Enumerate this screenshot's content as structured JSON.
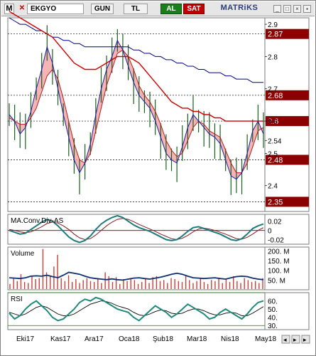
{
  "toolbar": {
    "logo_label": "M",
    "close_label": "✕",
    "symbol": "EKGYO",
    "period": "GUN",
    "currency": "TL",
    "buy_label": "AL",
    "sell_label": "SAT",
    "brand": "MATRiKS"
  },
  "colors": {
    "price_up": "#1b5e20",
    "ma_fast": "#1a1aa8",
    "ma_mid": "#cc0000",
    "ma_slow": "#000080",
    "band_fill": "#f4a3a3",
    "price_label_bg": "#8b0000",
    "volume_bar": "#c8403a",
    "macd_line": "#1f7a7a",
    "signal_line": "#7a1f1f"
  },
  "chart_data": [
    {
      "type": "line",
      "name": "price-panel",
      "title": "",
      "x_labels": [
        "Eki17",
        "Kas17",
        "Ara17",
        "Oca18",
        "Şub18",
        "Mar18",
        "Nis18",
        "May18"
      ],
      "price_levels": [
        "2.87",
        "2.68",
        "2.6",
        "2.48",
        "2.35"
      ],
      "y_ticks": [
        "2.9",
        "2.8",
        "2.7",
        "2.6",
        "2.54",
        "2.5",
        "2.4"
      ],
      "ylim": [
        2.32,
        2.92
      ],
      "series": [
        {
          "values": [
            2.62,
            2.6,
            2.56,
            2.58,
            2.63,
            2.7,
            2.76,
            2.83,
            2.78,
            2.7,
            2.62,
            2.55,
            2.48,
            2.44,
            2.47,
            2.53,
            2.62,
            2.7,
            2.76,
            2.8,
            2.85,
            2.82,
            2.77,
            2.72,
            2.68,
            2.66,
            2.64,
            2.6,
            2.55,
            2.5,
            2.48,
            2.47,
            2.52,
            2.58,
            2.62,
            2.6,
            2.58,
            2.56,
            2.55,
            2.53,
            2.48,
            2.43,
            2.42,
            2.44,
            2.5,
            2.57,
            2.6,
            2.56
          ]
        },
        {
          "values": [
            2.61,
            2.6,
            2.59,
            2.59,
            2.61,
            2.64,
            2.69,
            2.74,
            2.76,
            2.73,
            2.67,
            2.6,
            2.53,
            2.48,
            2.47,
            2.5,
            2.57,
            2.64,
            2.71,
            2.76,
            2.81,
            2.82,
            2.8,
            2.76,
            2.71,
            2.68,
            2.66,
            2.63,
            2.59,
            2.54,
            2.51,
            2.49,
            2.5,
            2.54,
            2.58,
            2.6,
            2.59,
            2.57,
            2.56,
            2.55,
            2.51,
            2.47,
            2.44,
            2.44,
            2.47,
            2.52,
            2.57,
            2.58
          ]
        },
        {
          "values": [
            2.94,
            2.93,
            2.92,
            2.91,
            2.9,
            2.89,
            2.88,
            2.87,
            2.86,
            2.84,
            2.82,
            2.8,
            2.78,
            2.77,
            2.76,
            2.76,
            2.76,
            2.77,
            2.78,
            2.79,
            2.8,
            2.8,
            2.8,
            2.79,
            2.78,
            2.76,
            2.74,
            2.72,
            2.7,
            2.68,
            2.66,
            2.65,
            2.64,
            2.64,
            2.63,
            2.63,
            2.62,
            2.62,
            2.61,
            2.61,
            2.6,
            2.6,
            2.6,
            2.6,
            2.6,
            2.6,
            2.6,
            2.6
          ]
        },
        {
          "values": [
            2.92,
            2.91,
            2.9,
            2.9,
            2.89,
            2.88,
            2.88,
            2.87,
            2.86,
            2.86,
            2.85,
            2.85,
            2.84,
            2.84,
            2.83,
            2.83,
            2.83,
            2.83,
            2.83,
            2.83,
            2.83,
            2.83,
            2.83,
            2.82,
            2.82,
            2.81,
            2.81,
            2.8,
            2.8,
            2.79,
            2.79,
            2.78,
            2.78,
            2.77,
            2.77,
            2.76,
            2.76,
            2.75,
            2.75,
            2.75,
            2.74,
            2.74,
            2.73,
            2.73,
            2.73,
            2.72,
            2.72,
            2.72
          ]
        }
      ]
    },
    {
      "type": "line",
      "name": "macd-panel",
      "title": "MA.Conv.Div-AS",
      "y_ticks": [
        "0.02",
        "0",
        "-0.02"
      ],
      "ylim": [
        -0.03,
        0.035
      ],
      "series": [
        {
          "values": [
            0.0,
            -0.004,
            -0.008,
            -0.006,
            0.002,
            0.01,
            0.018,
            0.024,
            0.02,
            0.01,
            -0.002,
            -0.014,
            -0.022,
            -0.026,
            -0.022,
            -0.012,
            0.002,
            0.014,
            0.022,
            0.028,
            0.032,
            0.028,
            0.02,
            0.012,
            0.006,
            0.002,
            -0.002,
            -0.008,
            -0.014,
            -0.02,
            -0.022,
            -0.02,
            -0.012,
            -0.002,
            0.006,
            0.008,
            0.004,
            0.0,
            -0.004,
            -0.008,
            -0.014,
            -0.02,
            -0.022,
            -0.018,
            -0.008,
            0.004,
            0.01,
            0.014
          ]
        },
        {
          "values": [
            0.002,
            0.0,
            -0.003,
            -0.005,
            -0.003,
            0.002,
            0.008,
            0.015,
            0.018,
            0.016,
            0.01,
            0.002,
            -0.008,
            -0.016,
            -0.02,
            -0.018,
            -0.01,
            0.0,
            0.01,
            0.018,
            0.024,
            0.026,
            0.024,
            0.019,
            0.013,
            0.008,
            0.003,
            -0.002,
            -0.008,
            -0.013,
            -0.018,
            -0.02,
            -0.017,
            -0.011,
            -0.003,
            0.003,
            0.005,
            0.003,
            0.0,
            -0.004,
            -0.008,
            -0.013,
            -0.018,
            -0.019,
            -0.015,
            -0.008,
            0.0,
            0.006
          ]
        }
      ]
    },
    {
      "type": "bar",
      "name": "volume-panel",
      "title": "Volume",
      "y_ticks": [
        "200. M",
        "150. M",
        "100. M",
        "50. M"
      ],
      "ylim": [
        0,
        220
      ],
      "values": [
        30,
        60,
        45,
        80,
        40,
        35,
        70,
        55,
        60,
        210,
        90,
        70,
        120,
        180,
        60,
        45,
        75,
        40,
        55,
        35,
        50,
        60,
        45,
        40,
        55,
        35,
        90,
        70,
        40,
        65,
        30,
        55,
        45,
        60,
        50,
        30,
        40,
        55,
        35,
        65,
        70,
        45,
        50,
        35,
        60,
        55,
        45,
        40,
        70,
        50,
        35,
        45,
        60,
        40,
        30,
        50,
        45,
        60,
        35,
        55,
        40,
        70,
        45,
        35,
        60,
        50,
        40,
        45,
        35,
        60
      ],
      "series": [
        {
          "values": [
            62,
            60,
            58,
            62,
            70,
            72,
            70,
            75,
            68,
            62,
            75,
            90,
            85,
            80,
            70,
            62,
            58,
            55,
            52,
            56,
            52,
            50,
            55,
            60,
            62,
            58,
            55,
            60,
            65,
            72,
            80,
            85,
            80,
            70,
            62,
            60,
            58,
            60,
            62,
            58,
            55,
            62,
            68,
            70,
            68,
            60,
            55,
            52
          ]
        }
      ]
    },
    {
      "type": "line",
      "name": "rsi-panel",
      "title": "RSI",
      "y_ticks": [
        "60.",
        "50.",
        "40.",
        "30."
      ],
      "ylim": [
        25,
        70
      ],
      "series": [
        {
          "values": [
            45,
            38,
            42,
            50,
            56,
            60,
            54,
            48,
            40,
            36,
            38,
            44,
            50,
            58,
            62,
            60,
            64,
            62,
            58,
            54,
            50,
            48,
            46,
            40,
            36,
            42,
            48,
            54,
            50,
            46,
            40,
            44,
            50,
            56,
            52,
            48,
            44,
            38,
            40,
            46,
            50,
            46,
            42,
            38,
            44,
            52,
            58,
            60
          ]
        },
        {
          "values": [
            46,
            44,
            42,
            44,
            48,
            52,
            54,
            52,
            48,
            44,
            42,
            42,
            44,
            48,
            52,
            56,
            58,
            60,
            59,
            57,
            54,
            52,
            50,
            46,
            43,
            42,
            44,
            47,
            49,
            48,
            45,
            44,
            45,
            48,
            50,
            50,
            48,
            45,
            43,
            43,
            45,
            46,
            45,
            42,
            42,
            45,
            49,
            53
          ]
        }
      ]
    }
  ]
}
